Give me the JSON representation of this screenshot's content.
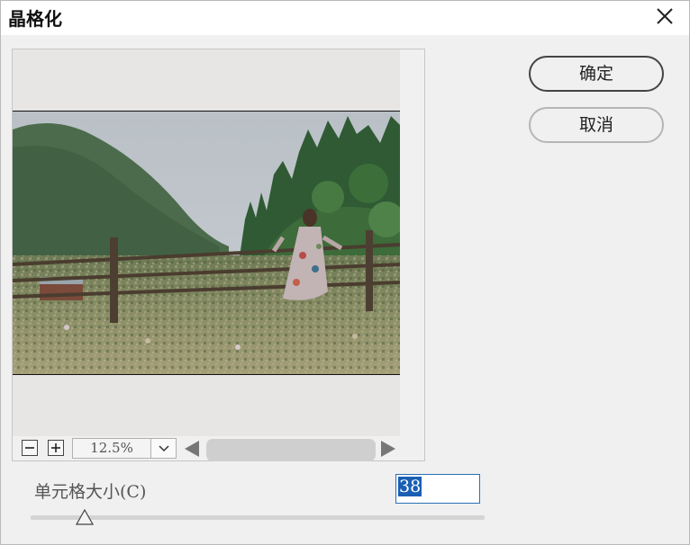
{
  "window": {
    "title": "晶格化",
    "close_icon": "close-icon"
  },
  "buttons": {
    "ok": "确定",
    "cancel": "取消"
  },
  "preview": {
    "zoom_out_icon": "minus-icon",
    "zoom_in_icon": "plus-icon",
    "zoom_value": "12.5%",
    "zoom_dropdown_icon": "chevron-down-icon",
    "scroll_left_icon": "triangle-left-icon",
    "scroll_right_icon": "triangle-right-icon"
  },
  "parameter": {
    "label": "单元格大小(C)",
    "value": "38",
    "slider_fraction": 0.12
  },
  "colors": {
    "accent": "#1a5fb4",
    "dialog_bg": "#f0f0f0"
  }
}
